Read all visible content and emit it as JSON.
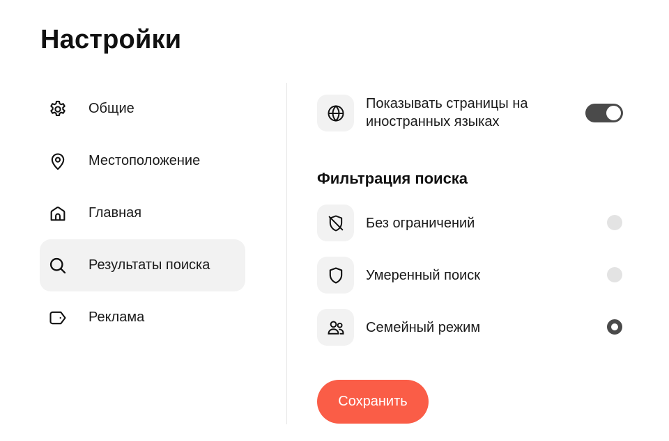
{
  "page": {
    "title": "Настройки"
  },
  "sidebar": {
    "items": [
      {
        "label": "Общие",
        "icon": "gear-icon"
      },
      {
        "label": "Местоположение",
        "icon": "location-pin-icon"
      },
      {
        "label": "Главная",
        "icon": "home-icon"
      },
      {
        "label": "Результаты поиска",
        "icon": "search-icon",
        "active": true
      },
      {
        "label": "Реклама",
        "icon": "tag-icon"
      }
    ]
  },
  "settings": {
    "foreign_pages": {
      "label_line1": "Показывать страницы на",
      "label_line2": "иностранных языках",
      "icon": "globe-icon",
      "enabled": true
    },
    "filter": {
      "title": "Фильтрация поиска",
      "options": [
        {
          "label": "Без ограничений",
          "icon": "shield-off-icon",
          "selected": false
        },
        {
          "label": "Умеренный поиск",
          "icon": "shield-icon",
          "selected": false
        },
        {
          "label": "Семейный режим",
          "icon": "family-icon",
          "selected": true
        }
      ]
    }
  },
  "actions": {
    "save_label": "Сохранить"
  },
  "colors": {
    "accent": "#fa5d47",
    "toggle_on": "#4a4a4a",
    "active_nav_bg": "#f2f2f2",
    "icon_bg": "#f2f2f2"
  }
}
